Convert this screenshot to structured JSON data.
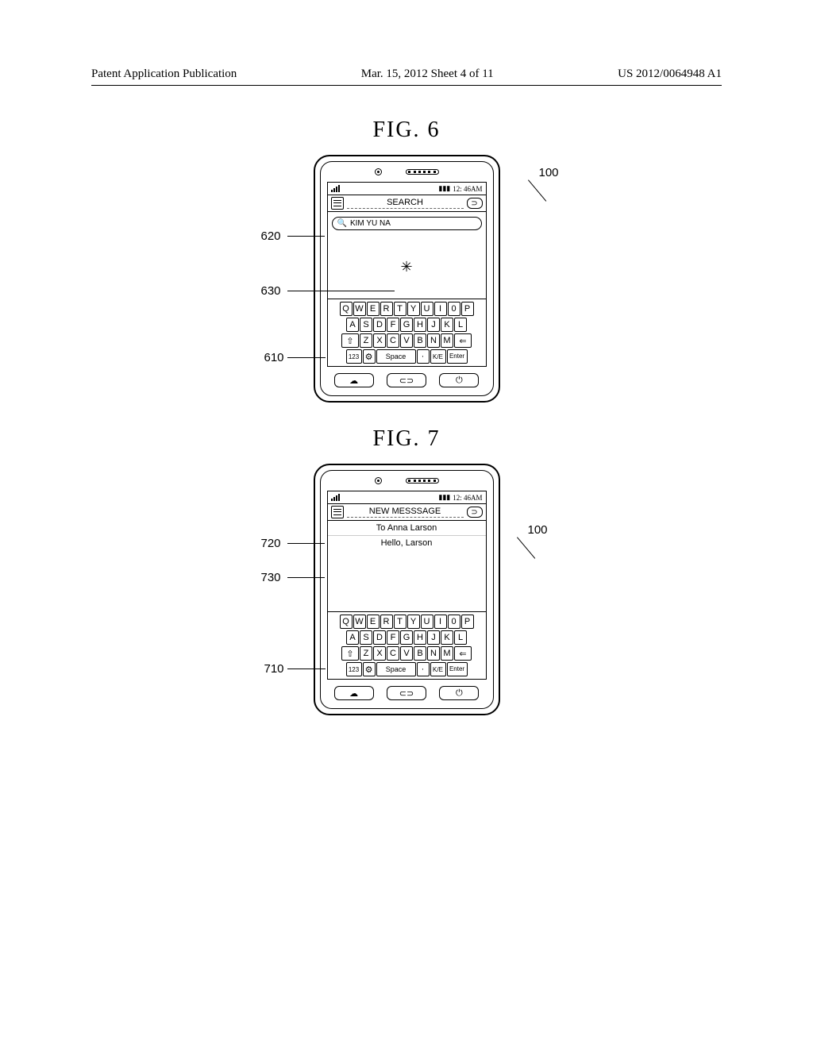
{
  "header": {
    "left": "Patent Application Publication",
    "middle": "Mar. 15, 2012  Sheet 4 of 11",
    "right": "US 2012/0064948 A1"
  },
  "fig6": {
    "label": "FIG.  6",
    "device_ref": "100",
    "leads": {
      "l1": "620",
      "l2": "630",
      "l3": "610"
    },
    "status_time": "12: 46AM",
    "title": "SEARCH",
    "search_text": "KIM YU NA",
    "keyboard": {
      "row1": [
        "Q",
        "W",
        "E",
        "R",
        "T",
        "Y",
        "U",
        "I",
        "0",
        "P"
      ],
      "row2": [
        "A",
        "S",
        "D",
        "F",
        "G",
        "H",
        "J",
        "K",
        "L"
      ],
      "row3_shift": "⇧",
      "row3": [
        "Z",
        "X",
        "C",
        "V",
        "B",
        "N",
        "M"
      ],
      "row3_del": "⇐",
      "row4_num": "123",
      "row4_gear": "⚙",
      "row4_space": "Space",
      "row4_dot": "·",
      "row4_lang": "K/E",
      "row4_enter": "Enter"
    }
  },
  "fig7": {
    "label": "FIG.  7",
    "device_ref": "100",
    "leads": {
      "l1": "720",
      "l2": "730",
      "l3": "710"
    },
    "status_time": "12: 46AM",
    "title": "NEW MESSSAGE",
    "to_line": "To Anna Larson",
    "body_text": "Hello, Larson",
    "keyboard": {
      "row1": [
        "Q",
        "W",
        "E",
        "R",
        "T",
        "Y",
        "U",
        "I",
        "0",
        "P"
      ],
      "row2": [
        "A",
        "S",
        "D",
        "F",
        "G",
        "H",
        "J",
        "K",
        "L"
      ],
      "row3_shift": "⇧",
      "row3": [
        "Z",
        "X",
        "C",
        "V",
        "B",
        "N",
        "M"
      ],
      "row3_del": "⇐",
      "row4_num": "123",
      "row4_gear": "⚙",
      "row4_space": "Space",
      "row4_dot": "·",
      "row4_lang": "K/E",
      "row4_enter": "Enter"
    }
  }
}
